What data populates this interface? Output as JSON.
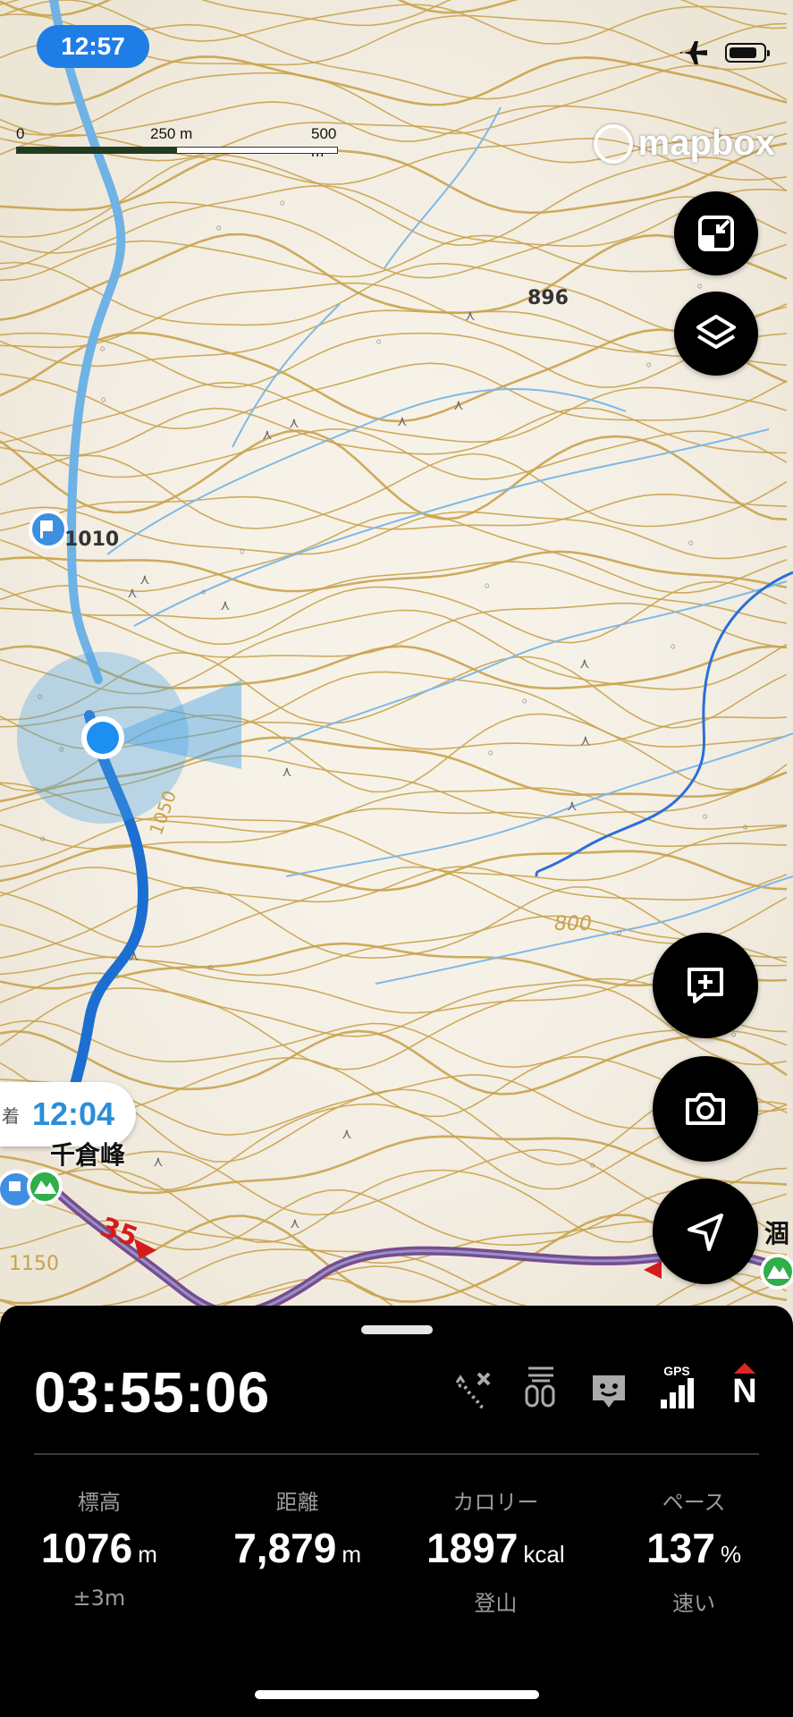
{
  "status_bar": {
    "time": "12:57",
    "icons": [
      "airplane-icon",
      "battery-icon"
    ]
  },
  "map": {
    "scale_labels": [
      "0",
      "250 m",
      "500 m"
    ],
    "attribution": "mapbox",
    "elevation_labels": [
      "896",
      "1010",
      "1050",
      "800",
      "1150"
    ],
    "route_marker": "35",
    "peak_label": "千倉峰",
    "right_label": "涸",
    "arrival_prefix": "着",
    "arrival_time": "12:04"
  },
  "map_buttons": [
    "collapse-icon",
    "layers-icon",
    "add-memo-icon",
    "camera-icon",
    "navigate-icon"
  ],
  "panel": {
    "elapsed": "03:55:06",
    "status_icons": [
      "route-off-icon",
      "waypoints-icon",
      "face-icon",
      "gps-signal-icon",
      "compass-north-icon"
    ],
    "gps_label": "GPS",
    "north_label": "N",
    "stats": [
      {
        "label": "標高",
        "value": "1076",
        "unit": "m",
        "sub": "±3m"
      },
      {
        "label": "距離",
        "value": "7,879",
        "unit": "m",
        "sub": ""
      },
      {
        "label": "カロリー",
        "value": "1897",
        "unit": "kcal",
        "sub": "登山"
      },
      {
        "label": "ペース",
        "value": "137",
        "unit": "%",
        "sub": "速い"
      }
    ]
  },
  "colors": {
    "accent": "#1f7ee6",
    "route": "#7b4a8f",
    "contour": "#c8a24a"
  }
}
